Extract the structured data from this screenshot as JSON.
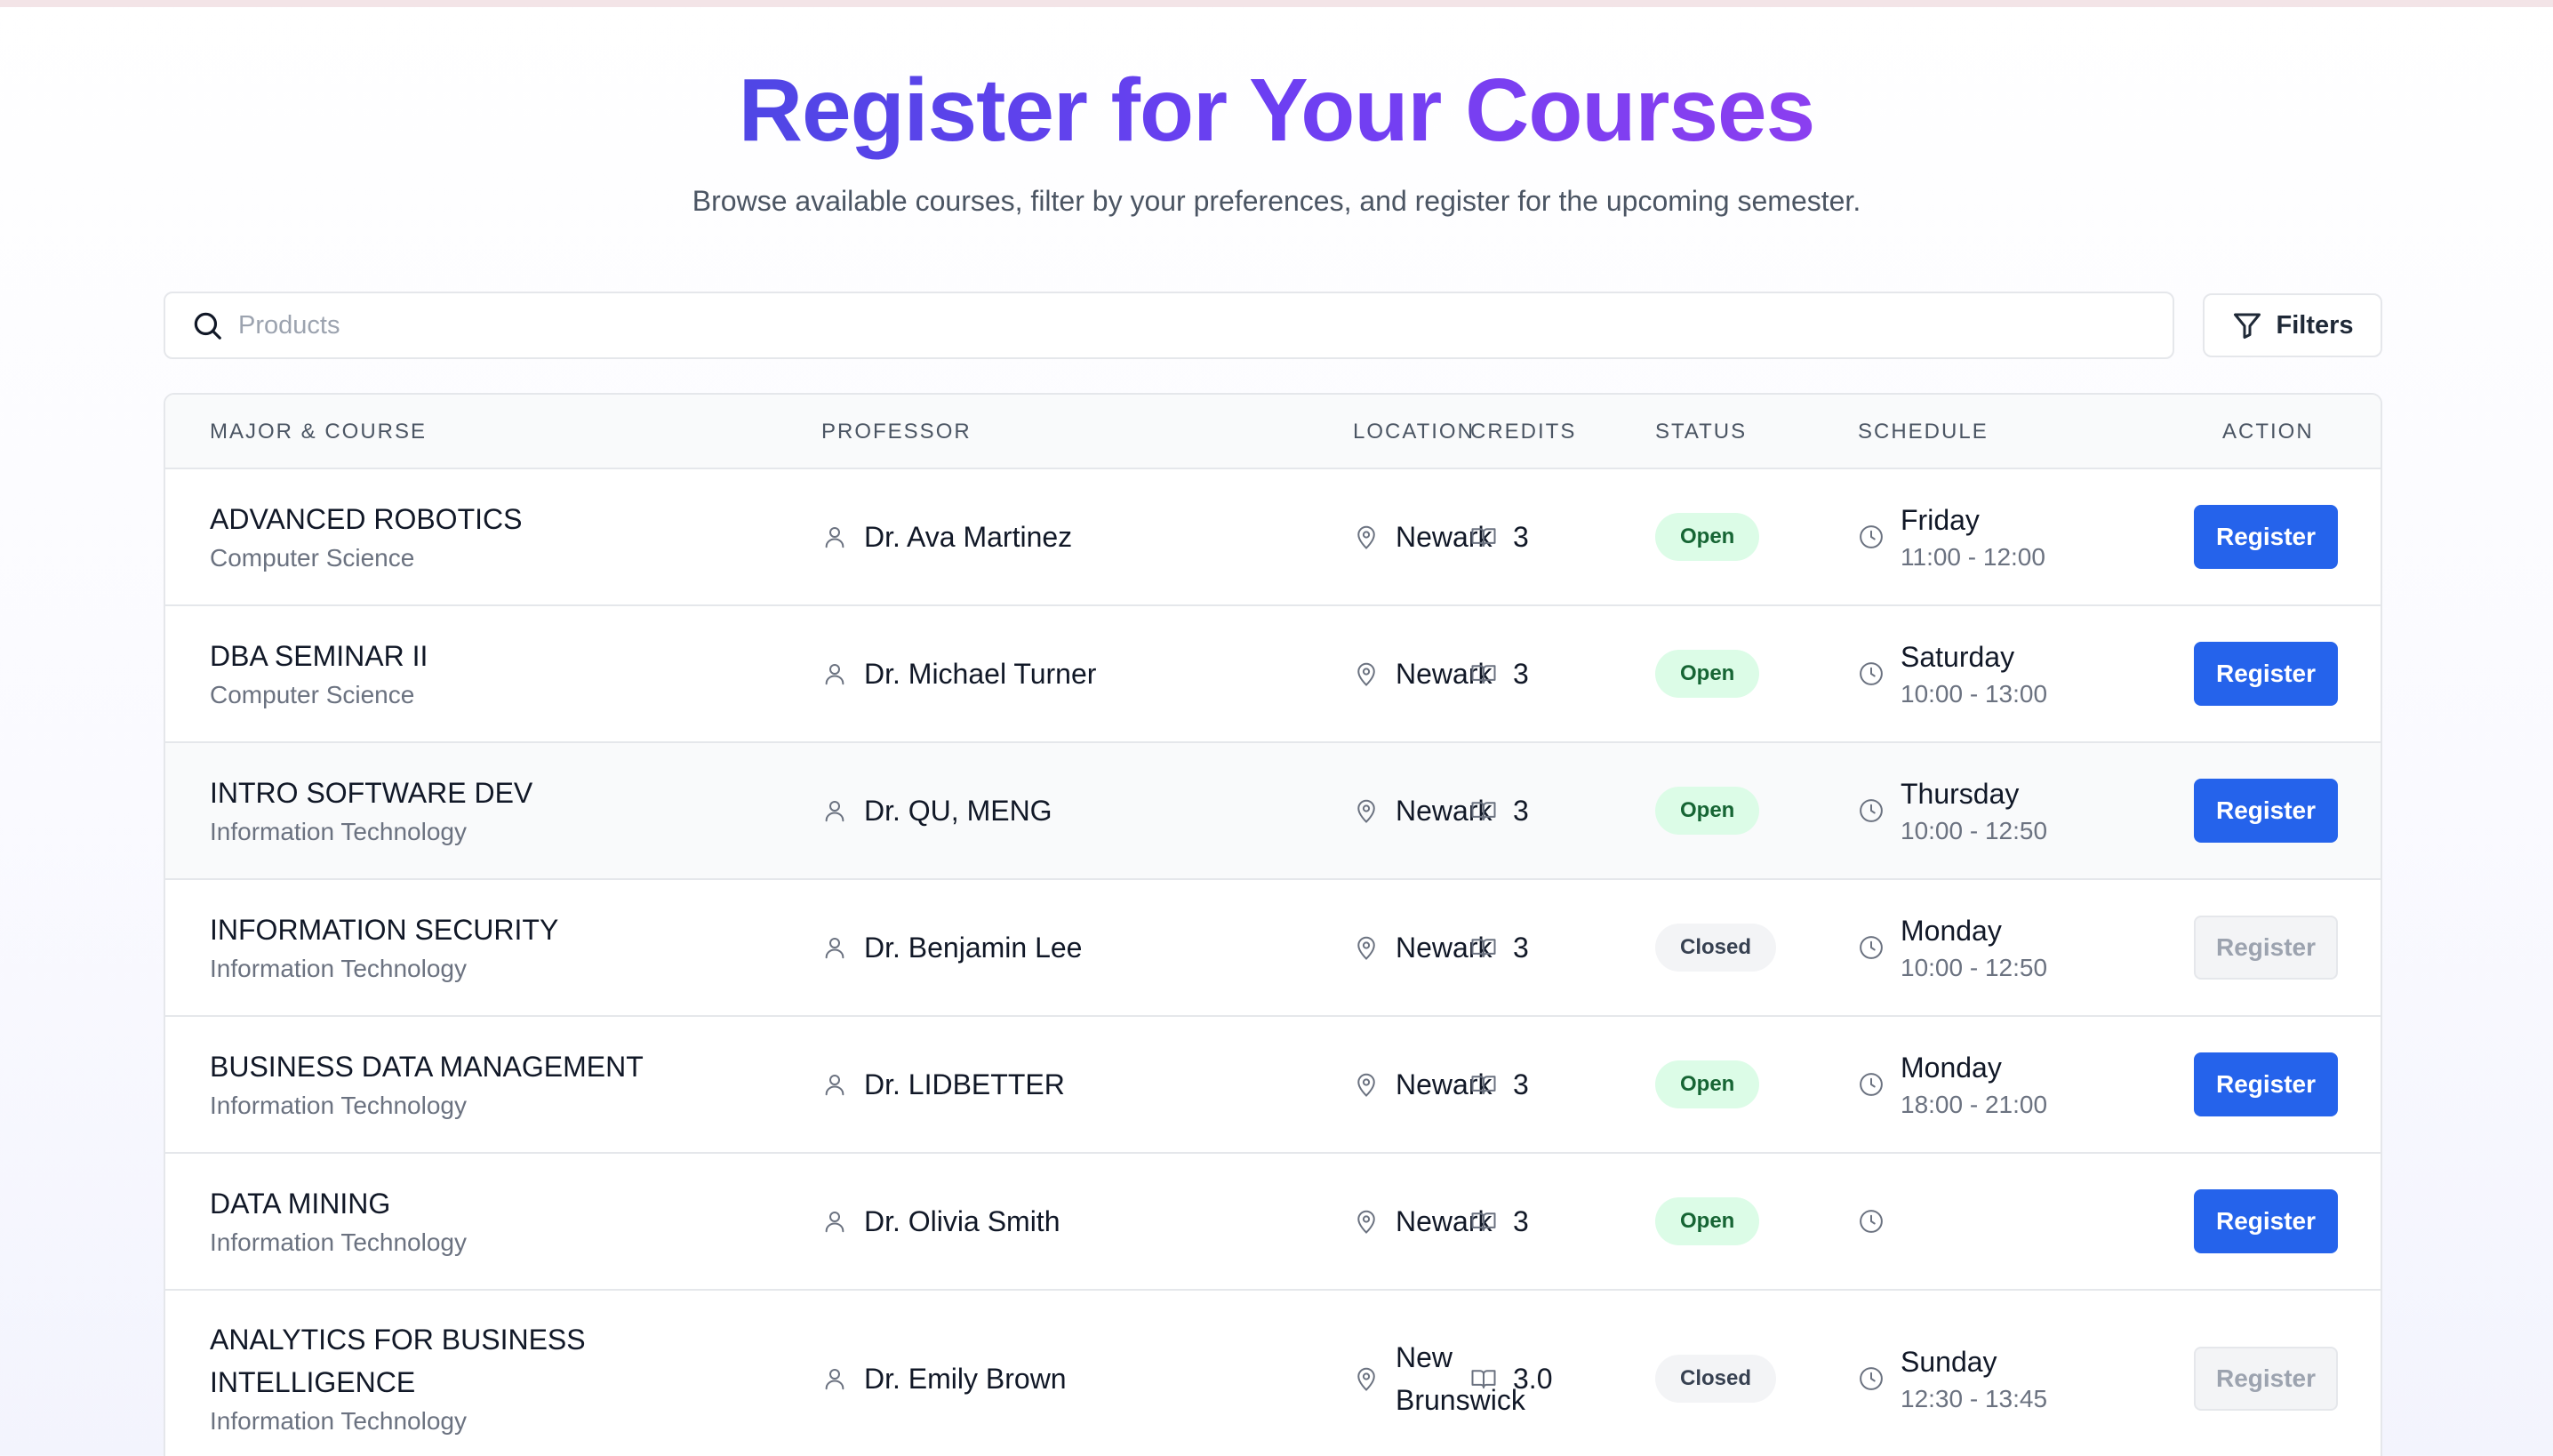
{
  "header": {
    "title": "Register for Your Courses",
    "subtitle": "Browse available courses, filter by your preferences, and register for the upcoming semester."
  },
  "search": {
    "placeholder": "Products",
    "value": ""
  },
  "filters_label": "Filters",
  "columns": [
    "MAJOR & COURSE",
    "PROFESSOR",
    "LOCATION",
    "CREDITS",
    "STATUS",
    "SCHEDULE",
    "ACTION"
  ],
  "courses": [
    {
      "name": "ADVANCED ROBOTICS",
      "major": "Computer Science",
      "professor": "Dr. Ava Martinez",
      "location": "Newark",
      "credits": "3",
      "status": "Open",
      "day": "Friday",
      "time": "11:00 - 12:00",
      "action": "Register",
      "enabled": true
    },
    {
      "name": "DBA SEMINAR II",
      "major": "Computer Science",
      "professor": "Dr. Michael Turner",
      "location": "Newark",
      "credits": "3",
      "status": "Open",
      "day": "Saturday",
      "time": "10:00 - 13:00",
      "action": "Register",
      "enabled": true
    },
    {
      "name": "INTRO SOFTWARE DEV",
      "major": "Information Technology",
      "professor": "Dr. QU, MENG",
      "location": "Newark",
      "credits": "3",
      "status": "Open",
      "day": "Thursday",
      "time": "10:00 - 12:50",
      "action": "Register",
      "enabled": true
    },
    {
      "name": "INFORMATION SECURITY",
      "major": "Information Technology",
      "professor": "Dr. Benjamin Lee",
      "location": "Newark",
      "credits": "3",
      "status": "Closed",
      "day": "Monday",
      "time": "10:00 - 12:50",
      "action": "Register",
      "enabled": false
    },
    {
      "name": "BUSINESS DATA MANAGEMENT",
      "major": "Information Technology",
      "professor": "Dr. LIDBETTER",
      "location": "Newark",
      "credits": "3",
      "status": "Open",
      "day": "Monday",
      "time": "18:00 - 21:00",
      "action": "Register",
      "enabled": true
    },
    {
      "name": "DATA MINING",
      "major": "Information Technology",
      "professor": "Dr. Olivia Smith",
      "location": "Newark",
      "credits": "3",
      "status": "Open",
      "day": "",
      "time": "",
      "action": "Register",
      "enabled": true
    },
    {
      "name": "ANALYTICS FOR BUSINESS INTELLIGENCE",
      "major": "Information Technology",
      "professor": "Dr. Emily Brown",
      "location": "New Brunswick",
      "credits": "3.0",
      "status": "Closed",
      "day": "Sunday",
      "time": "12:30 - 13:45",
      "action": "Register",
      "enabled": false
    }
  ],
  "colors": {
    "title_gradient_start": "#4f46e5",
    "title_gradient_end": "#8b3ff0",
    "register_button": "#2563eb",
    "open_badge_bg": "#dcfce7",
    "open_badge_text": "#166534",
    "closed_badge_bg": "#f3f4f6"
  },
  "icons": {
    "search": "search-icon",
    "filters": "filter-icon",
    "professor": "user-icon",
    "location": "map-pin-icon",
    "credits": "book-icon",
    "schedule": "clock-icon"
  }
}
